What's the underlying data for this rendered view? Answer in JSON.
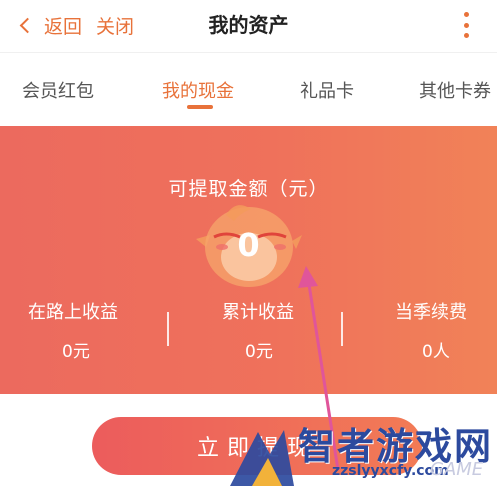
{
  "header": {
    "back_label": "返回",
    "close_label": "关闭",
    "title": "我的资产",
    "more_icon": "more-vertical-icon"
  },
  "tabs": [
    {
      "label": "会员红包",
      "active": false
    },
    {
      "label": "我的现金",
      "active": true
    },
    {
      "label": "礼品卡",
      "active": false
    },
    {
      "label": "其他卡券",
      "active": false
    }
  ],
  "cash_card": {
    "title": "可提取金额（元）",
    "amount": "0",
    "stats": [
      {
        "label": "在路上收益",
        "value": "0元"
      },
      {
        "label": "累计收益",
        "value": "0元"
      },
      {
        "label": "当季续费",
        "value": "0人"
      }
    ]
  },
  "withdraw_button": {
    "label": "立即提现"
  },
  "watermark": {
    "text": "智者游戏网",
    "url": "zzslyyxcfy.com",
    "tag": "GAME"
  },
  "colors": {
    "accent": "#e8723a",
    "card_start": "#ec6a5e",
    "card_end": "#f18258",
    "annotation_arrow": "#e0559a",
    "watermark": "#2c4a9e"
  }
}
